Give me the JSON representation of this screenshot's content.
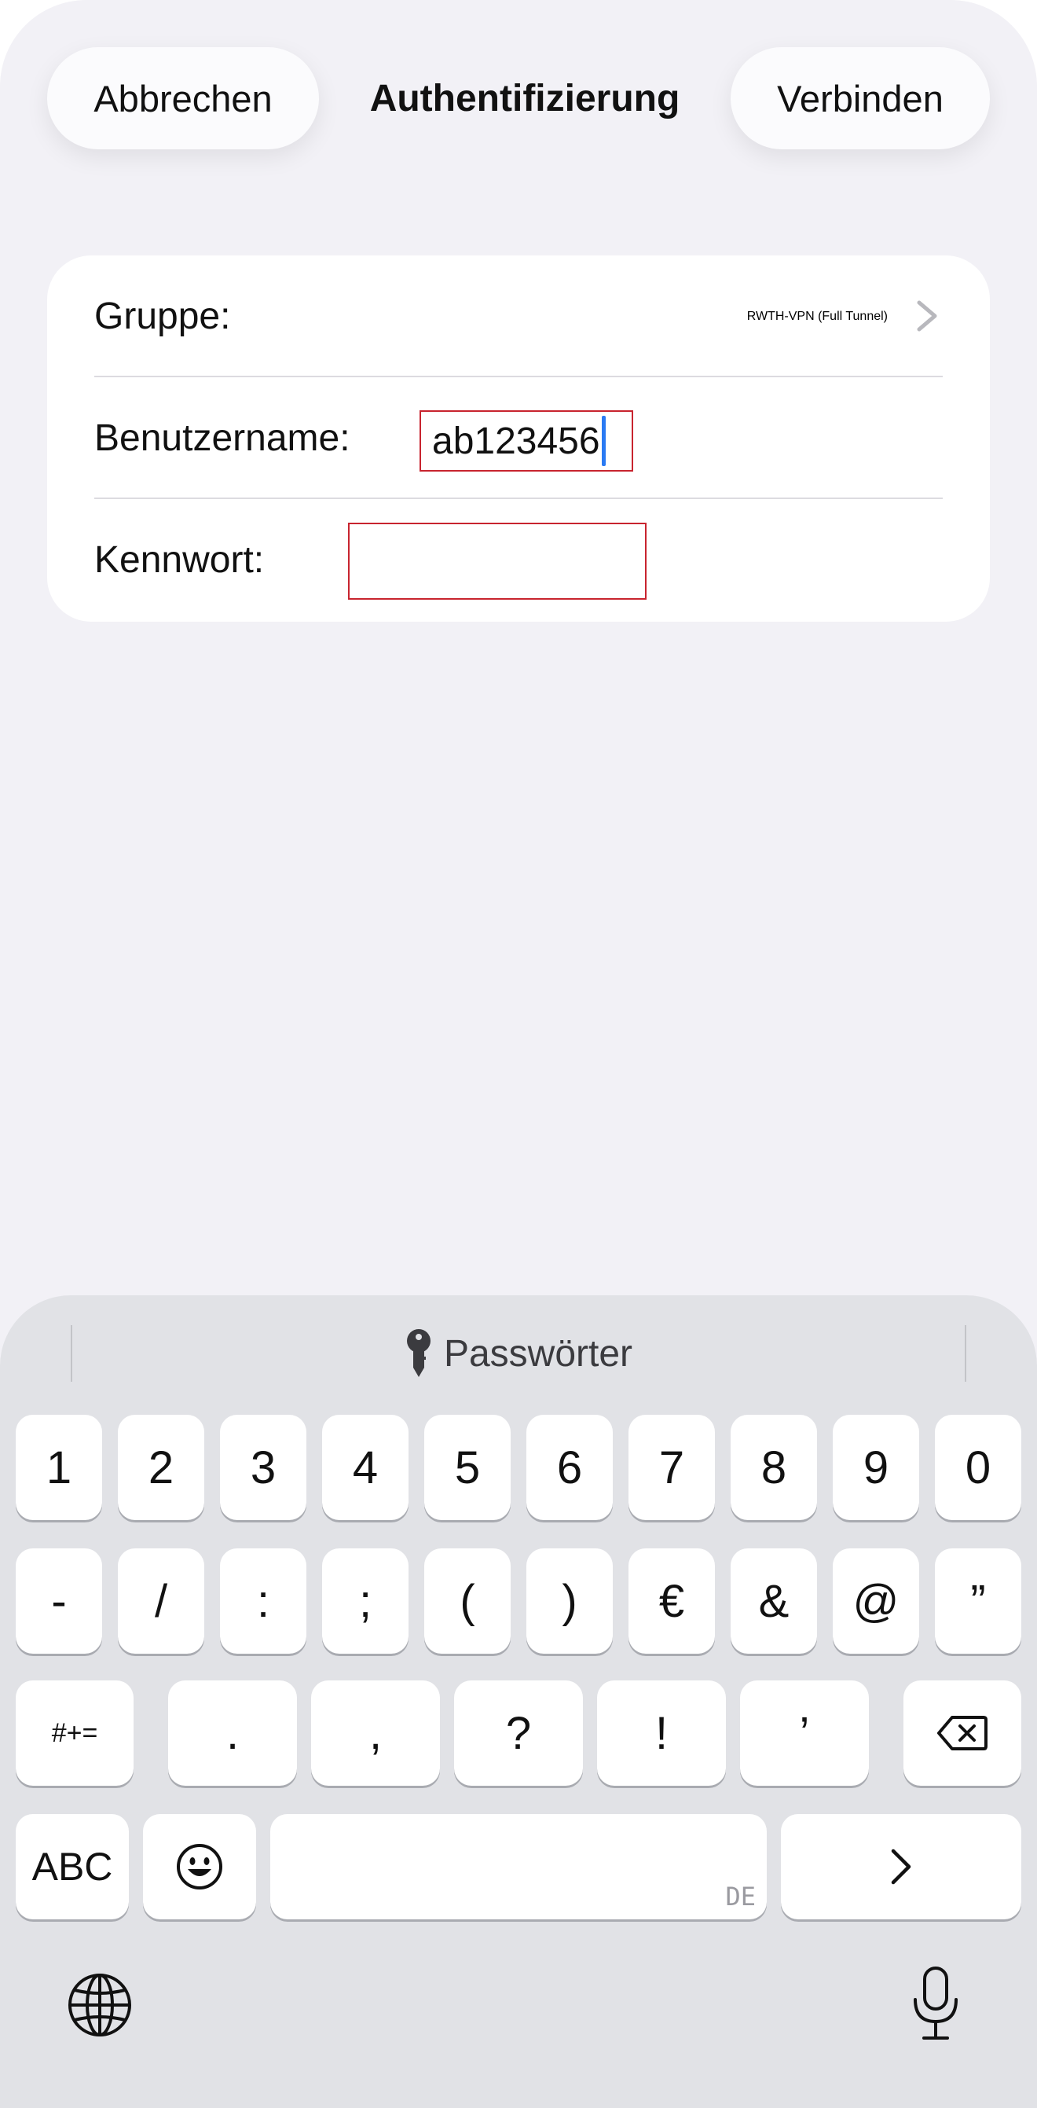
{
  "nav": {
    "cancel_label": "Abbrechen",
    "title": "Authentifizierung",
    "connect_label": "Verbinden"
  },
  "form": {
    "group_label": "Gruppe:",
    "group_value": "RWTH-VPN (Full Tunnel)",
    "username_label": "Benutzername:",
    "username_value": "ab123456",
    "password_label": "Kennwort:",
    "password_value": ""
  },
  "keyboard": {
    "passwords_label": "Passwörter",
    "row1": [
      "1",
      "2",
      "3",
      "4",
      "5",
      "6",
      "7",
      "8",
      "9",
      "0"
    ],
    "row2": [
      "-",
      "/",
      ":",
      ";",
      "(",
      ")",
      "€",
      "&",
      "@",
      "”"
    ],
    "row3": {
      "mode": "#+=",
      "keys": [
        ".",
        ",",
        "?",
        "!",
        "’"
      ]
    },
    "row4": {
      "abc": "ABC",
      "space_lang": "DE"
    }
  },
  "colors": {
    "accent_caret": "#2a7af3",
    "field_outline": "#c8242f",
    "background": "#f2f1f6",
    "keyboard_bg": "#e1e2e6"
  }
}
